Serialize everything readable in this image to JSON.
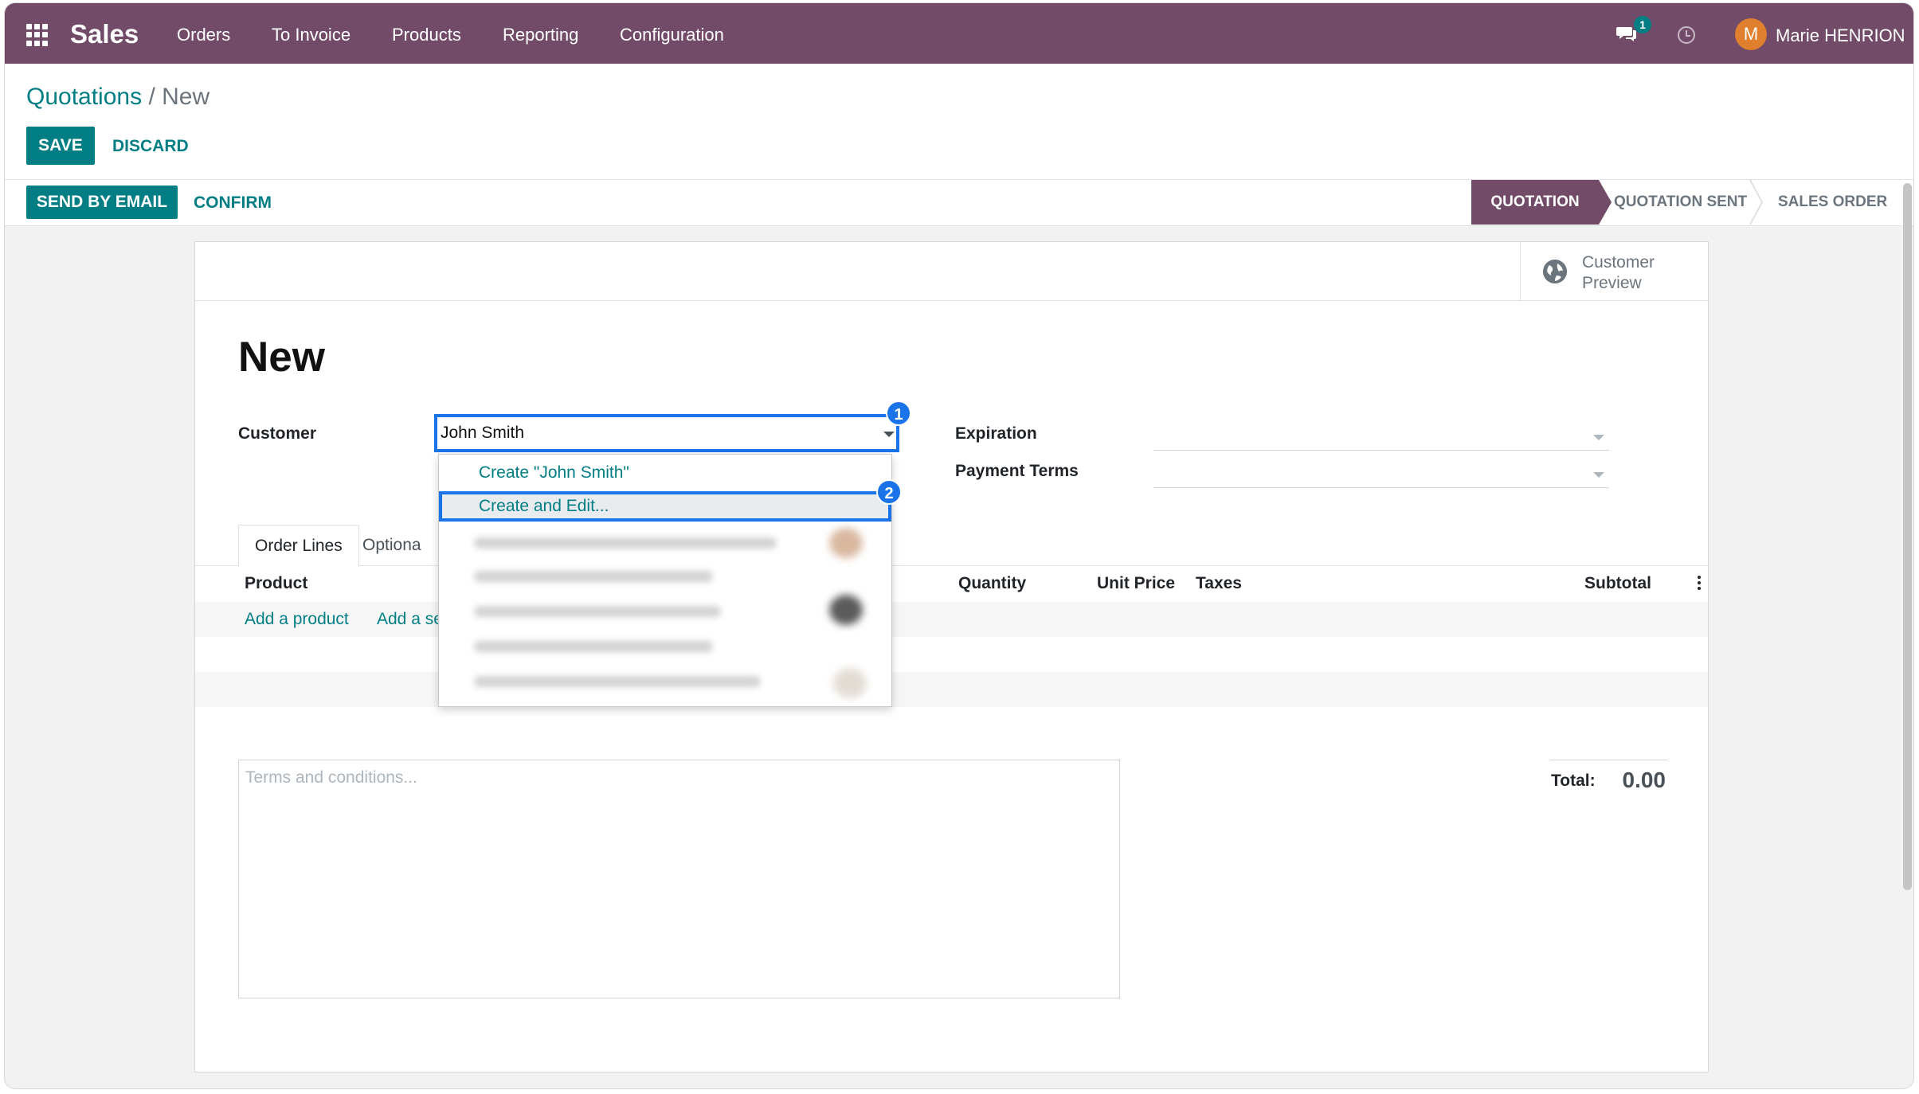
{
  "navbar": {
    "brand": "Sales",
    "menu": [
      "Orders",
      "To Invoice",
      "Products",
      "Reporting",
      "Configuration"
    ],
    "messages_count": "1",
    "user_initial": "M",
    "user_name": "Marie HENRION"
  },
  "breadcrumb": {
    "parent": "Quotations",
    "separator": "/",
    "current": "New"
  },
  "actions": {
    "save": "SAVE",
    "discard": "DISCARD"
  },
  "status_actions": {
    "send_email": "SEND BY EMAIL",
    "confirm": "CONFIRM"
  },
  "statusbar": {
    "steps": [
      "QUOTATION",
      "QUOTATION SENT",
      "SALES ORDER"
    ],
    "current": "QUOTATION"
  },
  "form": {
    "preview_label": "Customer Preview",
    "title": "New",
    "customer_label": "Customer",
    "customer_value": "John Smith",
    "expiration_label": "Expiration",
    "payment_terms_label": "Payment Terms",
    "dropdown": {
      "create": "Create \"John Smith\"",
      "create_edit": "Create and Edit..."
    },
    "tabs": [
      "Order Lines",
      "Optiona"
    ],
    "columns": {
      "product": "Product",
      "quantity": "Quantity",
      "unit_price": "Unit Price",
      "taxes": "Taxes",
      "subtotal": "Subtotal"
    },
    "add_product": "Add a product",
    "add_section": "Add a se",
    "terms_placeholder": "Terms and conditions...",
    "total_label": "Total:",
    "total_value": "0.00"
  },
  "callouts": [
    "1",
    "2"
  ],
  "colors": {
    "brand": "#714b67",
    "primary": "#017e84",
    "callout": "#1a73e8"
  }
}
